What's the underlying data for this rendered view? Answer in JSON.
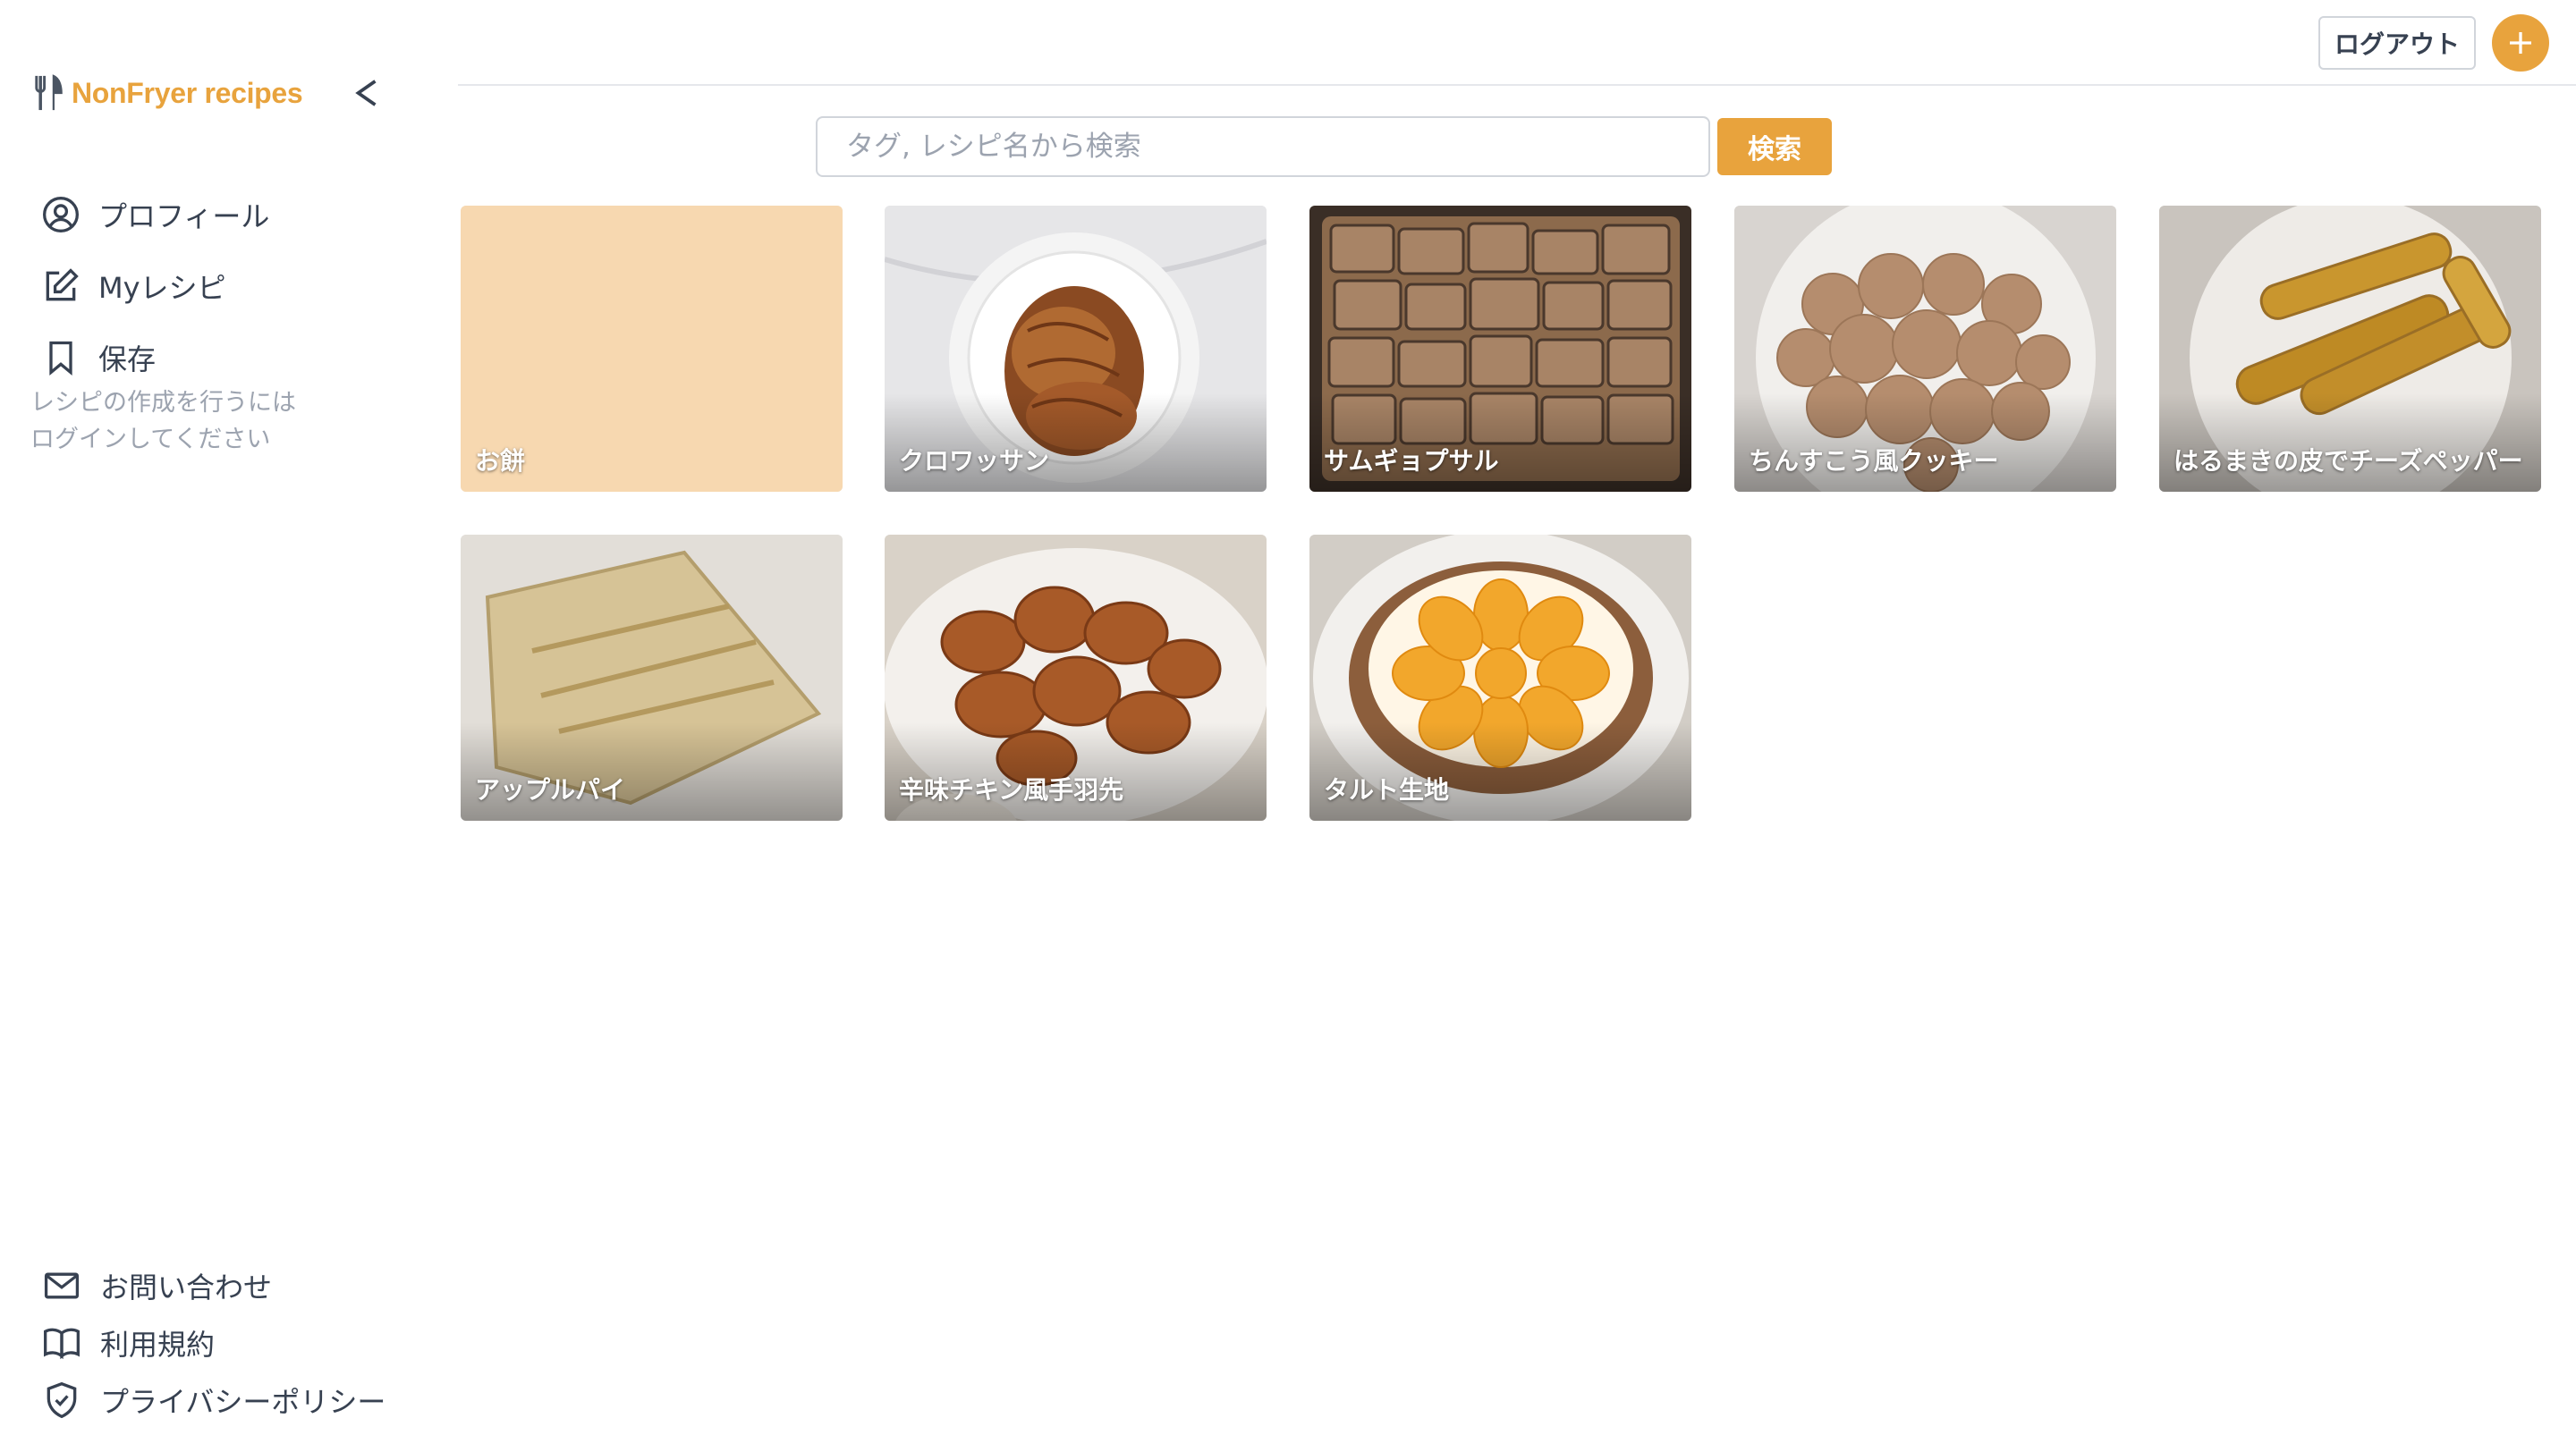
{
  "app": {
    "name": "NonFryer recipes",
    "brand_color": "#E8A33D",
    "collapse_label": "<"
  },
  "sidebar": {
    "items": [
      {
        "label": "プロフィール",
        "icon": "user-circle-icon"
      },
      {
        "label": "Myレシピ",
        "icon": "edit-square-icon"
      },
      {
        "label": "保存",
        "icon": "bookmark-icon"
      }
    ],
    "login_hint": "レシピの作成を行うには\nログインしてください",
    "footer_items": [
      {
        "label": "お問い合わせ",
        "icon": "mail-icon"
      },
      {
        "label": "利用規約",
        "icon": "book-open-icon"
      },
      {
        "label": "プライバシーポリシー",
        "icon": "shield-check-icon"
      }
    ]
  },
  "header": {
    "logout_label": "ログアウト",
    "add_icon": "plus-icon"
  },
  "search": {
    "placeholder": "タグ, レシピ名から検索",
    "value": "",
    "button_label": "検索"
  },
  "recipes": [
    {
      "title": "お餅",
      "thumb_color": "#F7D8B0"
    },
    {
      "title": "クロワッサン",
      "thumb_color": "#DADADA"
    },
    {
      "title": "サムギョプサル",
      "thumb_color": "#6B5A4A"
    },
    {
      "title": "ちんすこう風クッキー",
      "thumb_color": "#D9CFC6"
    },
    {
      "title": "はるまきの皮でチーズペッパー",
      "thumb_color": "#CFC9C2"
    },
    {
      "title": "アップルパイ",
      "thumb_color": "#D8CCAE"
    },
    {
      "title": "辛味チキン風手羽先",
      "thumb_color": "#C9B8A4"
    },
    {
      "title": "タルト生地",
      "thumb_color": "#D4CFC8"
    }
  ]
}
